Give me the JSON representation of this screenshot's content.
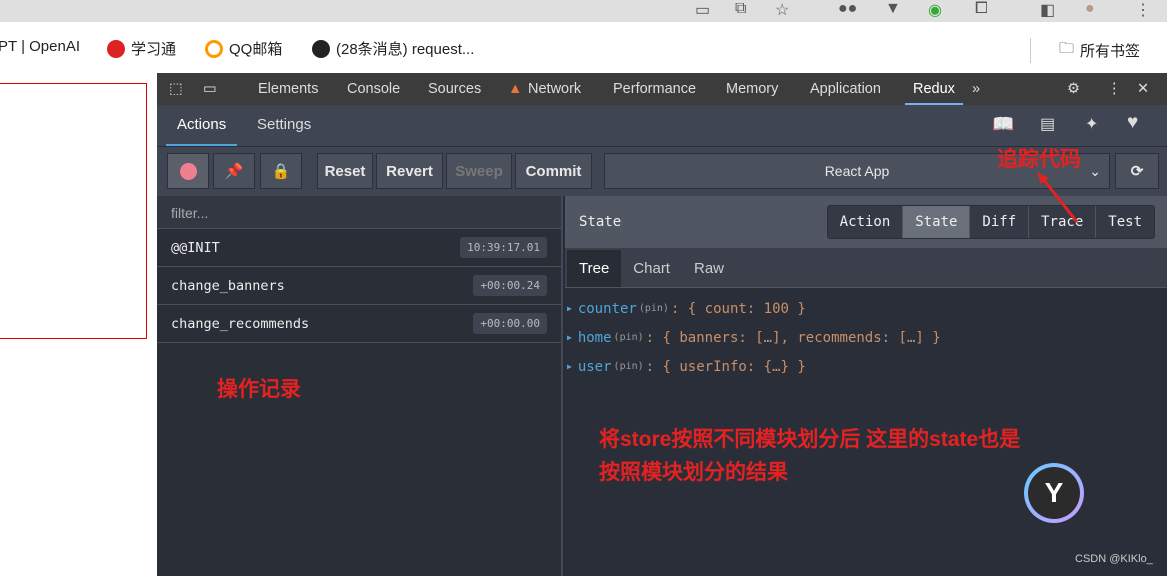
{
  "bookmarks": [
    {
      "label": "PT | OpenAI"
    },
    {
      "label": "学习通"
    },
    {
      "label": "QQ邮箱"
    },
    {
      "label": "(28条消息) request..."
    }
  ],
  "bookmarks_folder": "所有书签",
  "devtools_tabs": [
    "Elements",
    "Console",
    "Sources",
    "Network",
    "Performance",
    "Memory",
    "Application",
    "Redux"
  ],
  "active_tab": "Redux",
  "redux_tabs": [
    "Actions",
    "Settings"
  ],
  "toolbar": {
    "reset": "Reset",
    "revert": "Revert",
    "sweep": "Sweep",
    "commit": "Commit",
    "instance": "React App"
  },
  "filter_placeholder": "filter...",
  "actions": [
    {
      "name": "@@INIT",
      "time": "10:39:17.01"
    },
    {
      "name": "change_banners",
      "time": "+00:00.24"
    },
    {
      "name": "change_recommends",
      "time": "+00:00.00"
    }
  ],
  "state_title": "State",
  "monitor_tabs": [
    "Action",
    "State",
    "Diff",
    "Trace",
    "Test"
  ],
  "sub_tabs": [
    "Tree",
    "Chart",
    "Raw"
  ],
  "tree": [
    {
      "key": "counter",
      "pin": "(pin)",
      "value": ": { count: 100 }"
    },
    {
      "key": "home",
      "pin": "(pin)",
      "value": ": { banners: […], recommends: […] }"
    },
    {
      "key": "user",
      "pin": "(pin)",
      "value": ": { userInfo: {…} }"
    }
  ],
  "annotations": {
    "trace": "追踪代码",
    "log": "操作记录",
    "note1": "将store按照不同模块划分后 这里的state也是",
    "note2": "按照模块划分的结果"
  },
  "watermark": "CSDN @KIKlo_"
}
